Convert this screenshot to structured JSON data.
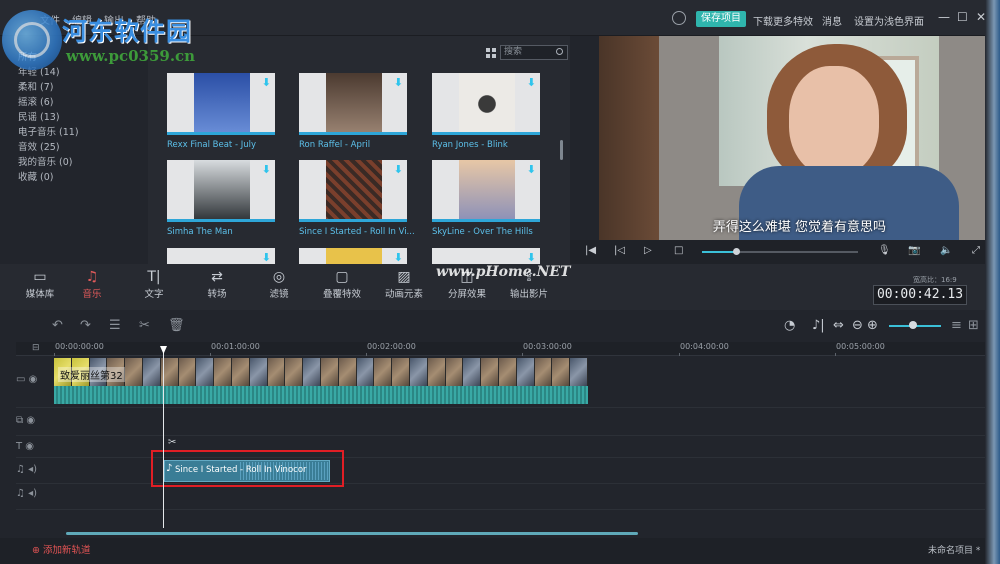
{
  "watermark": {
    "site_cn": "河东软件园",
    "url": "www.pc0359.cn",
    "center": "www.pHome.NET"
  },
  "menu": [
    "文件",
    "编辑",
    "输出",
    "帮助"
  ],
  "topbar": {
    "save": "保存项目",
    "download": "下载更多特效",
    "messages": "消息",
    "light_ui": "设置为浅色界面",
    "win_min": "—",
    "win_max": "☐",
    "win_close": "✕"
  },
  "library": {
    "categories": [
      "所有",
      "年轻 (14)",
      "柔和 (7)",
      "摇滚 (6)",
      "民谣 (13)",
      "电子音乐 (11)",
      "音效 (25)",
      "我的音乐 (0)",
      "收藏 (0)"
    ],
    "search_placeholder": "搜索",
    "tracks": [
      "Rexx Final Beat - July",
      "Ron Raffel - April",
      "Ryan Jones - Blink",
      "Simha The Man",
      "Since I Started - Roll In Vi...",
      "SkyLine - Over The Hills"
    ]
  },
  "preview": {
    "subtitle": "弄得这么难堪 您觉着有意思吗"
  },
  "toolbar": {
    "items": [
      "媒体库",
      "音乐",
      "文字",
      "转场",
      "滤镜",
      "叠覆特效",
      "动画元素",
      "分屏效果",
      "输出影片"
    ],
    "active": "音乐",
    "ratio": "宽高比：16:9",
    "timecode": "00:00:42.13"
  },
  "ruler": [
    "00:00:00:00",
    "00:01:00:00",
    "00:02:00:00",
    "00:03:00:00",
    "00:04:00:00",
    "00:05:00:00"
  ],
  "timeline": {
    "video_clip_name": "致爱丽丝第32",
    "audio_clip_name": "Since I Started - Roll In Vinocor",
    "add_track": "添加新轨道",
    "project_name": "未命名项目 *"
  },
  "colors": {
    "accent": "#2fb5ad",
    "active": "#e05a5a",
    "highlight_box": "#e01e25"
  }
}
